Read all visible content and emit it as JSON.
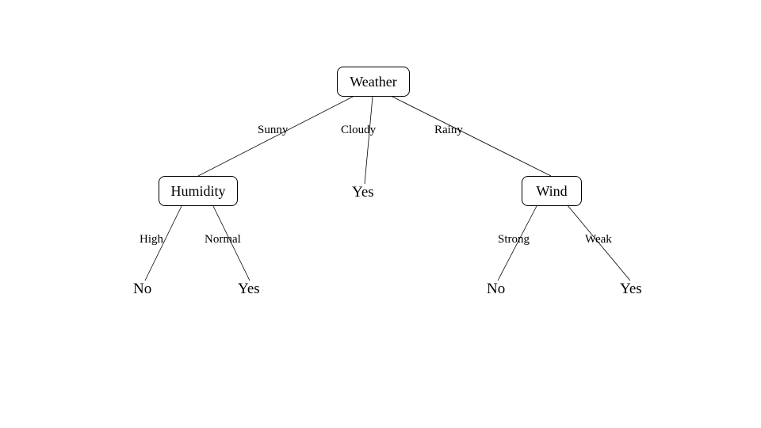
{
  "tree": {
    "root": {
      "label": "Weather"
    },
    "edges": {
      "sunny": "Sunny",
      "cloudy": "Cloudy",
      "rainy": "Rainy",
      "high": "High",
      "normal": "Normal",
      "strong": "Strong",
      "weak": "Weak"
    },
    "nodes": {
      "humidity": "Humidity",
      "wind": "Wind"
    },
    "leaves": {
      "cloudy_leaf": "Yes",
      "high_leaf": "No",
      "normal_leaf": "Yes",
      "strong_leaf": "No",
      "weak_leaf": "Yes"
    }
  }
}
